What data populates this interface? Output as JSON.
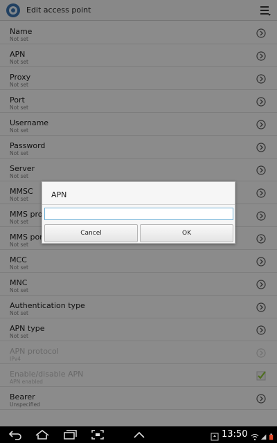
{
  "action_bar": {
    "title": "Edit access point"
  },
  "settings": [
    {
      "title": "Name",
      "value": "Not set"
    },
    {
      "title": "APN",
      "value": "Not set"
    },
    {
      "title": "Proxy",
      "value": "Not set"
    },
    {
      "title": "Port",
      "value": "Not set"
    },
    {
      "title": "Username",
      "value": "Not set"
    },
    {
      "title": "Password",
      "value": "Not set"
    },
    {
      "title": "Server",
      "value": "Not set"
    },
    {
      "title": "MMSC",
      "value": "Not set"
    },
    {
      "title": "MMS pro",
      "value": "Not set"
    },
    {
      "title": "MMS por",
      "value": "Not set"
    },
    {
      "title": "MCC",
      "value": "Not set"
    },
    {
      "title": "MNC",
      "value": "Not set"
    },
    {
      "title": "Authentication type",
      "value": "Not set"
    },
    {
      "title": "APN type",
      "value": "Not set"
    },
    {
      "title": "APN protocol",
      "value": "IPv4",
      "disabled": true
    },
    {
      "title": "Enable/disable APN",
      "value": "APN enabled",
      "disabled": true,
      "checked": true
    },
    {
      "title": "Bearer",
      "value": "Unspecified"
    }
  ],
  "dialog": {
    "title": "APN",
    "input_value": "",
    "cancel_label": "Cancel",
    "ok_label": "OK"
  },
  "status_bar": {
    "time": "13:50"
  },
  "colors": {
    "dim_overlay": "#000000",
    "input_focus": "#6fb0d6",
    "check_green": "#8bbf3c"
  }
}
